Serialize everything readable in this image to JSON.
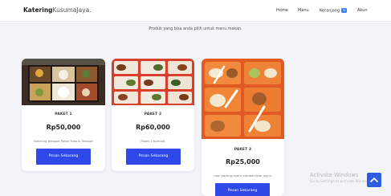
{
  "navbar": {
    "brand_bold": "Katering",
    "brand_light": "KusumaJaya.",
    "links": [
      "Home",
      "Menu",
      "Keranjang",
      "Akun"
    ],
    "cart_count": "0"
  },
  "page": {
    "subtitle": "Produk yang bisa anda pilih untuk menu makan."
  },
  "products": [
    {
      "title": "PAKET 1",
      "price": "Rp50,000",
      "description": "Katering dengan Paket Toko & Tempat",
      "button": "Pesan Sekarang"
    },
    {
      "title": "PAKET 2",
      "price": "Rp60,000",
      "description": "Paket 2 Komplit",
      "button": "Pesan Sekarang"
    },
    {
      "title": "PAKET 3",
      "price": "Rp25,000",
      "description": "nasi goreng,ayam,sambal,telor,sayur",
      "button": "Pesan Sekarang"
    }
  ],
  "watermark": {
    "title": "Activate Windows",
    "subtitle": "Go to Settings to activate Windows."
  },
  "colors": {
    "accent": "#2f49e8",
    "badge": "#3b82f6",
    "page_bg": "#f3f4f8"
  },
  "icons": {
    "scroll_top": "chevron-up-icon"
  }
}
